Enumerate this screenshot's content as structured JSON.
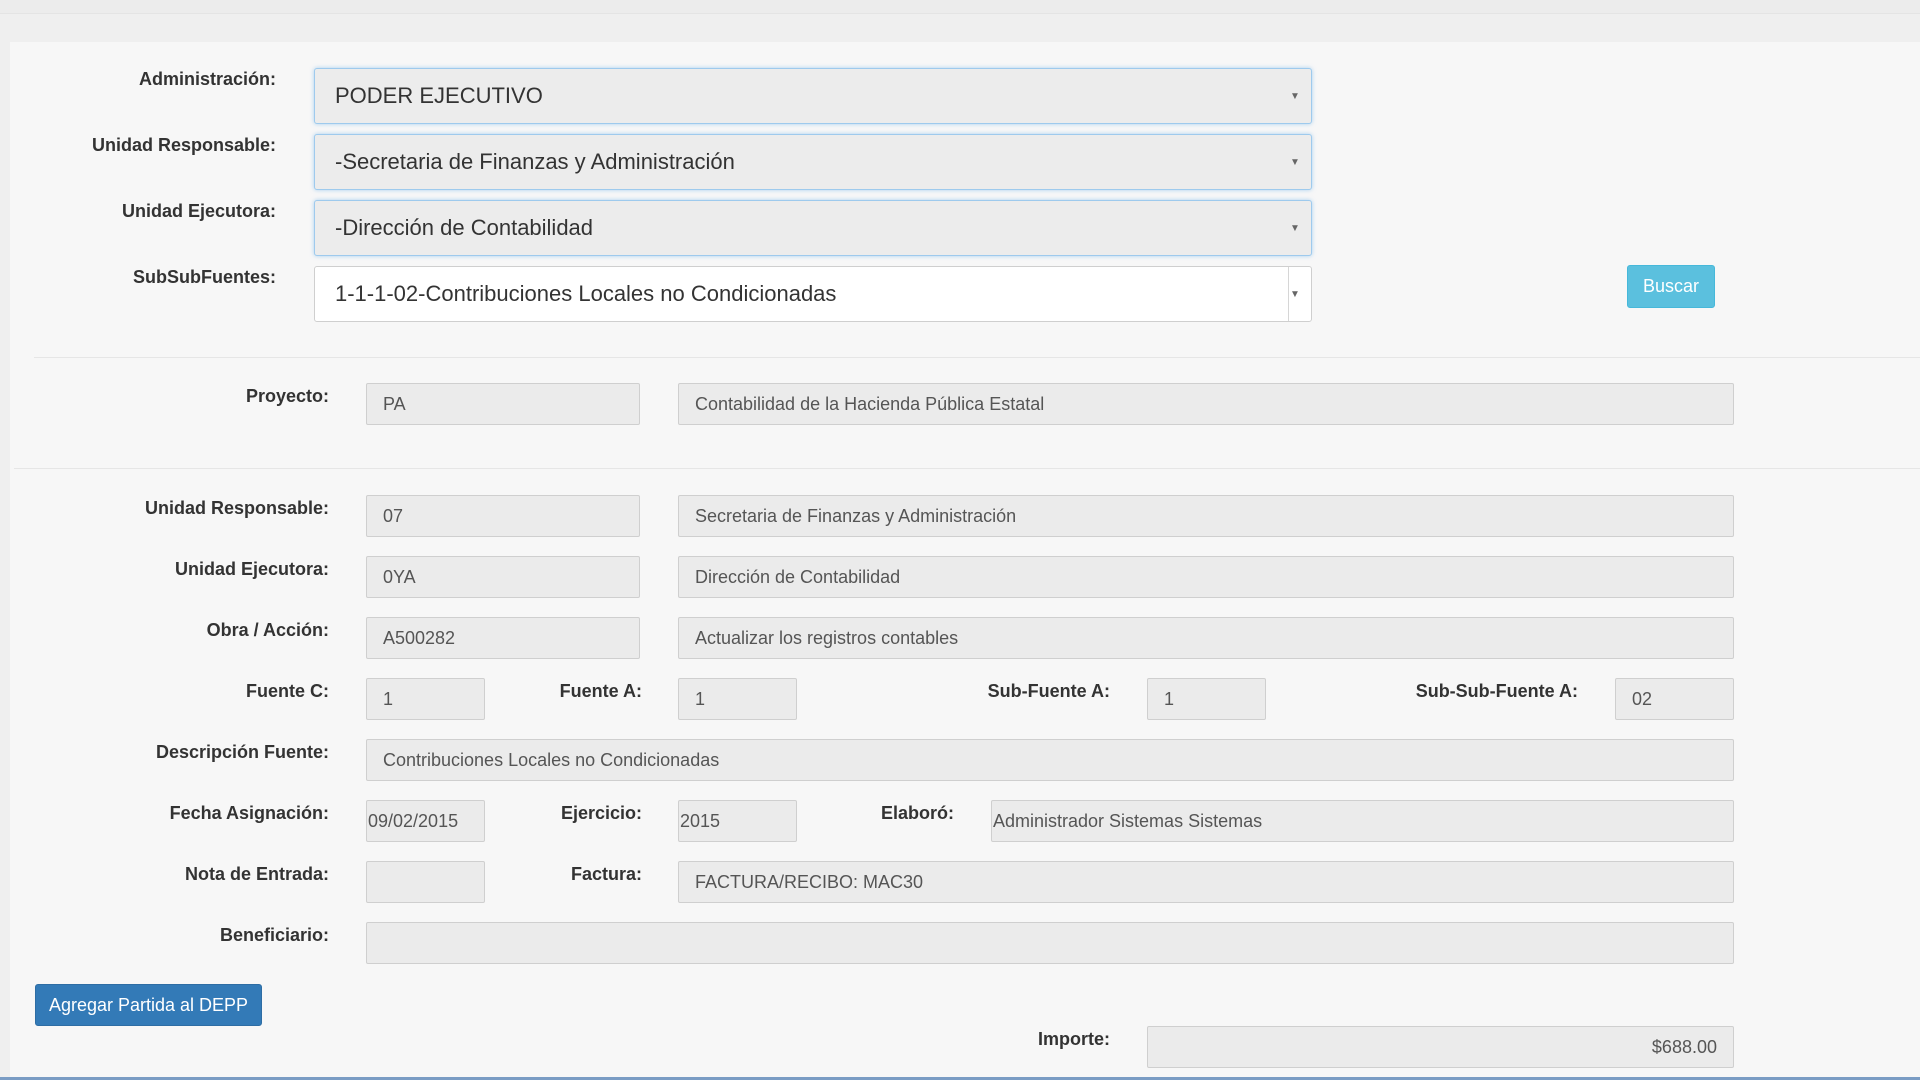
{
  "filters": {
    "administracion": {
      "label": "Administración:",
      "value": "PODER EJECUTIVO"
    },
    "unidad_responsable": {
      "label": "Unidad Responsable:",
      "value": "-Secretaria de Finanzas y Administración"
    },
    "unidad_ejecutora": {
      "label": "Unidad Ejecutora:",
      "value": "-Dirección de Contabilidad"
    },
    "subsubfuentes": {
      "label": "SubSubFuentes:",
      "value": "1-1-1-02-Contribuciones Locales no Condicionadas"
    },
    "buscar_label": "Buscar",
    "caret_icon": "chevron-down-icon"
  },
  "proyecto": {
    "label": "Proyecto:",
    "code": "PA",
    "name": "Contabilidad de la Hacienda Pública Estatal"
  },
  "detail": {
    "unidad_responsable": {
      "label": "Unidad Responsable:",
      "code": "07",
      "name": "Secretaria de Finanzas y Administración"
    },
    "unidad_ejecutora": {
      "label": "Unidad Ejecutora:",
      "code": "0YA",
      "name": "Dirección de Contabilidad"
    },
    "obra_accion": {
      "label": "Obra / Acción:",
      "code": "A500282",
      "name": "Actualizar los registros contables"
    },
    "fuente_c": {
      "label": "Fuente C:",
      "value": "1"
    },
    "fuente_a": {
      "label": "Fuente A:",
      "value": "1"
    },
    "sub_fuente_a": {
      "label": "Sub-Fuente A:",
      "value": "1"
    },
    "sub_sub_fuente_a": {
      "label": "Sub-Sub-Fuente A:",
      "value": "02"
    },
    "descripcion_fuente": {
      "label": "Descripción Fuente:",
      "value": "Contribuciones Locales no Condicionadas"
    },
    "fecha_asignacion": {
      "label": "Fecha Asignación:",
      "value": "09/02/2015"
    },
    "ejercicio": {
      "label": "Ejercicio:",
      "value": "2015"
    },
    "elaboro": {
      "label": "Elaboró:",
      "value": "Administrador Sistemas Sistemas"
    },
    "nota_entrada": {
      "label": "Nota de Entrada:",
      "value": ""
    },
    "factura": {
      "label": "Factura:",
      "value": "FACTURA/RECIBO: MAC30"
    },
    "beneficiario": {
      "label": "Beneficiario:",
      "value": ""
    },
    "importe": {
      "label": "Importe:",
      "value": "$688.00"
    }
  },
  "actions": {
    "add_label": "Agregar Partida al DEPP"
  },
  "colors": {
    "info_button": "#5bc0de",
    "primary_button": "#337ab7",
    "focus_border": "#9ecaed"
  }
}
